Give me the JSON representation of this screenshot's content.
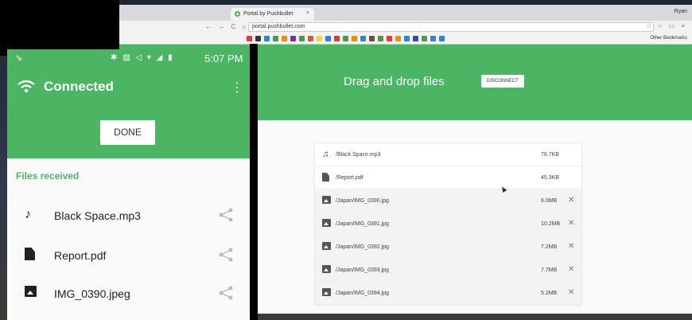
{
  "browser": {
    "tab_title": "Portal by Pushbullet",
    "tab_close": "×",
    "user": "Ryan",
    "url": "portal.pushbullet.com",
    "nav": "← → C ⌂",
    "omni_right": "☆ ○ ▭ ≡",
    "bookmarks_label": "Other Bookmarks"
  },
  "portal": {
    "header_title": "Drag and drop files",
    "disconnect_label": "DISCONNECT",
    "files": [
      {
        "icon": "music-note-icon",
        "name": "/Black Space.mp3",
        "size": "76.7KB",
        "closable": false
      },
      {
        "icon": "document-icon",
        "name": "/Report.pdf",
        "size": "45.3KB",
        "closable": false
      },
      {
        "icon": "image-icon",
        "name": "/Japan/IMG_0390.jpg",
        "size": "6.0MB",
        "closable": true
      },
      {
        "icon": "image-icon",
        "name": "/Japan/IMG_0391.jpg",
        "size": "10.2MB",
        "closable": true
      },
      {
        "icon": "image-icon",
        "name": "/Japan/IMG_0392.jpg",
        "size": "7.2MB",
        "closable": true
      },
      {
        "icon": "image-icon",
        "name": "/Japan/IMG_0393.jpg",
        "size": "7.7MB",
        "closable": true
      },
      {
        "icon": "image-icon",
        "name": "/Japan/IMG_0394.jpg",
        "size": "5.2MB",
        "closable": true
      }
    ],
    "close_glyph": "✕"
  },
  "phone": {
    "status_time": "5:07 PM",
    "status_icons": "✱ ▧ ◁ ▾ ◢ ▮",
    "title": "Connected",
    "menu_glyph": "⋮",
    "done_label": "DONE",
    "section_label": "Files received",
    "files": [
      {
        "icon": "music-note-icon",
        "name": "Black Space.mp3"
      },
      {
        "icon": "document-icon",
        "name": "Report.pdf"
      },
      {
        "icon": "image-icon",
        "name": "IMG_0390.jpeg"
      }
    ]
  },
  "colors": {
    "brand_green": "#4bb563"
  }
}
